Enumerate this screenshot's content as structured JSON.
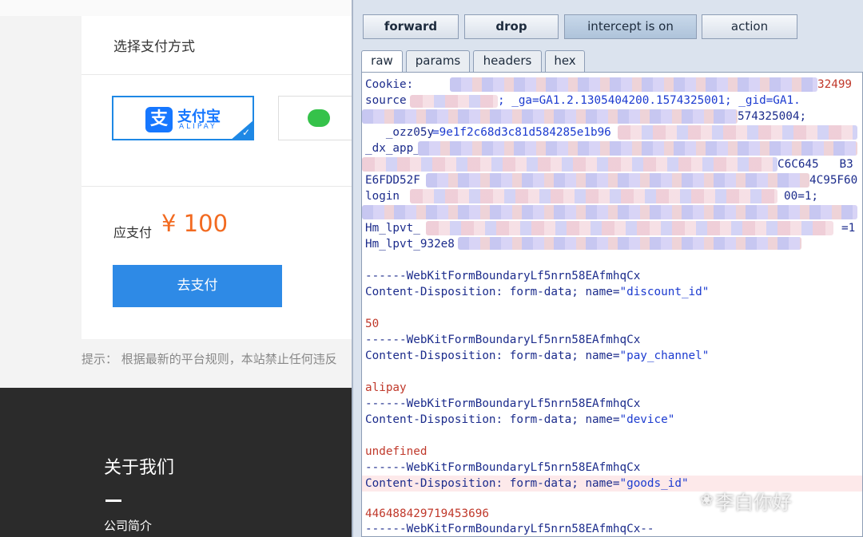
{
  "payment_page": {
    "method_title": "选择支付方式",
    "alipay_option": {
      "cn": "支付宝",
      "en": "ALIPAY",
      "logo_glyph": "支"
    },
    "wechat_option_icon": "wechat-icon",
    "due_label": "应支付",
    "due_amount": "¥ 100",
    "pay_button": "去支付",
    "tip": "提示： 根据最新的平台规则，本站禁止任何违反",
    "footer": {
      "about_title": "关于我们",
      "about_link": "公司简介"
    }
  },
  "tool": {
    "buttons": {
      "forward": "forward",
      "drop": "drop",
      "intercept": "intercept is on",
      "action": "action"
    },
    "tabs": {
      "raw": "raw",
      "params": "params",
      "headers": "headers",
      "hex": "hex"
    },
    "lines": {
      "l0_name": "Cookie:",
      "l0_tail": "32499",
      "l1_name": "source",
      "l1_value": "; _ga=GA1.2.1305404200.1574325001; _gid=GA1.",
      "l2_value": "574325004;",
      "l3_name": "   _ozz05y",
      "l3_value": "=9e1f2c68d3c81d584285e1b96",
      "l4_name": "_dx_app_",
      "l5_tail": "C6C645   B3",
      "l6_value": "E6FDD52F",
      "l6_tail": "4C95F60",
      "l7_name": "login",
      "l7_tail": "00=1;",
      "l8_name": "Hm_lpvt_",
      "l8_tail": "=1",
      "l9_name": "Hm_lpvt_932e8",
      "boundary": "------WebKitFormBoundaryLf5nrn58EAfmhqCx",
      "boundary_end": "------WebKitFormBoundaryLf5nrn58EAfmhqCx--",
      "disposition_prefix": "Content-Disposition: form-data; name=",
      "f1_name": "\"discount_id\"",
      "f1_value": "50",
      "f2_name": "\"pay_channel\"",
      "f2_value": "alipay",
      "f3_name": "\"device\"",
      "f3_value": "undefined",
      "f4_name": "\"goods_id\"",
      "f4_value": "446488429719453696"
    }
  },
  "watermark": {
    "icon": "wechat-icon",
    "text": "李白你好"
  },
  "colors": {
    "accent_blue": "#2e8ae6",
    "price_orange": "#f26a20",
    "form_value_red": "#c0392b",
    "tool_bg": "#dbe3ee"
  }
}
